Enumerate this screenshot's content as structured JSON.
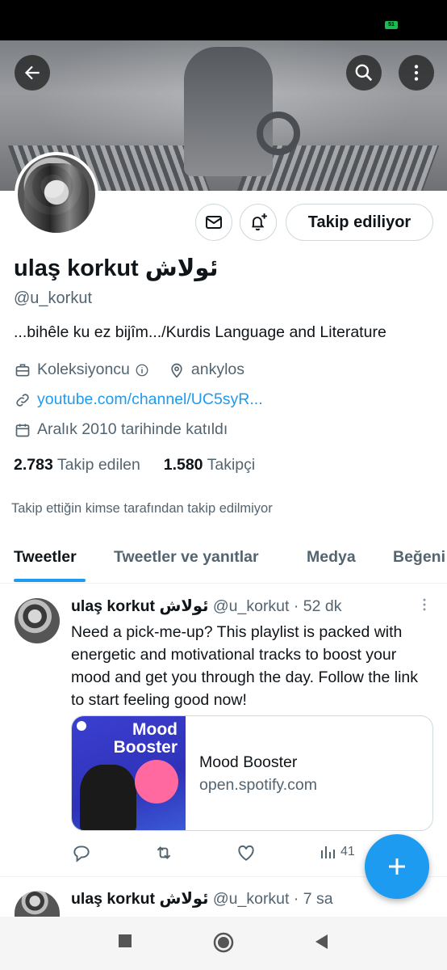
{
  "status": {
    "battery": "51"
  },
  "profile": {
    "name": "ulaş korkut ئولاش",
    "handle": "@u_korkut",
    "bio": "...bihêle ku ez bijîm.../Kurdis Language and Literature",
    "category": "Koleksiyoncu",
    "location": "ankylos",
    "link": "youtube.com/channel/UC5syR...",
    "joined": "Aralık 2010 tarihinde katıldı",
    "following_count": "2.783",
    "following_label": "Takip edilen",
    "followers_count": "1.580",
    "followers_label": "Takipçi",
    "not_followed_note": "Takip ettiğin kimse tarafından takip edilmiyor",
    "follow_button": "Takip ediliyor"
  },
  "tabs": [
    {
      "label": "Tweetler",
      "active": true
    },
    {
      "label": "Tweetler ve yanıtlar",
      "active": false
    },
    {
      "label": "Medya",
      "active": false
    },
    {
      "label": "Beğeni",
      "active": false
    }
  ],
  "tweets": [
    {
      "name": "ulaş korkut ئولاش",
      "handle": "@u_korkut",
      "time": "52 dk",
      "text": "Need a pick-me-up? This playlist is packed with energetic and motivational tracks to boost your mood and get you through the day. Follow the link to start feeling good now!",
      "card": {
        "image_text_1": "Mood",
        "image_text_2": "Booster",
        "title": "Mood Booster",
        "domain": "open.spotify.com"
      },
      "views": "41"
    },
    {
      "name": "ulaş korkut ئولاش",
      "handle": "@u_korkut",
      "time": "7 sa"
    }
  ],
  "colors": {
    "accent": "#1d9bf0",
    "text": "#0f1419",
    "muted": "#536471"
  }
}
